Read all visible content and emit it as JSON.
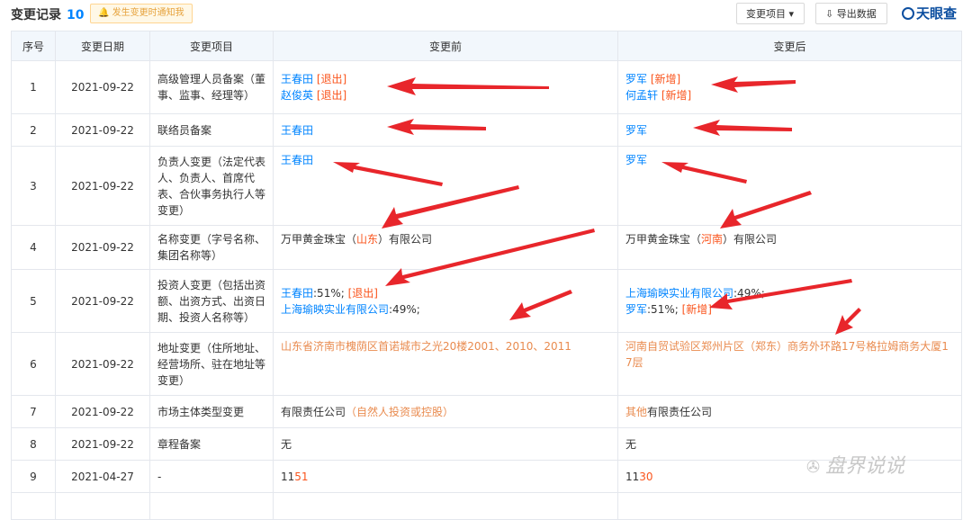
{
  "header": {
    "title": "变更记录",
    "count": "10",
    "tip": "🔔 发生变更时通知我",
    "filter_label": "变更项目 ▾",
    "export_label": "⇩ 导出数据",
    "logo": "天眼查"
  },
  "table": {
    "columns": [
      "序号",
      "变更日期",
      "变更项目",
      "变更前",
      "变更后"
    ],
    "rows": [
      {
        "no": "1",
        "date": "2021-09-22",
        "item": "高级管理人员备案（董事、监事、经理等）",
        "before": [
          {
            "n": "王春田",
            "t": "[退出]"
          },
          {
            "n": "赵俊英",
            "t": "[退出]"
          }
        ],
        "after": [
          {
            "n": "罗军",
            "t": "[新增]"
          },
          {
            "n": "何孟轩",
            "t": "[新增]"
          }
        ]
      },
      {
        "no": "2",
        "date": "2021-09-22",
        "item": "联络员备案",
        "before": "王春田",
        "after": "罗军"
      },
      {
        "no": "3",
        "date": "2021-09-22",
        "item": "负责人变更（法定代表人、负责人、首席代表、合伙事务执行人等变更）",
        "before": "王春田",
        "after": "罗军"
      },
      {
        "no": "4",
        "date": "2021-09-22",
        "item": "名称变更（字号名称、集团名称等）",
        "before": {
          "a": "万甲黄金珠宝（",
          "h": "山东",
          "b": "）有限公司"
        },
        "after": {
          "a": "万甲黄金珠宝（",
          "h": "河南",
          "b": "）有限公司"
        }
      },
      {
        "no": "5",
        "date": "2021-09-22",
        "item": "投资人变更（包括出资额、出资方式、出资日期、投资人名称等）",
        "before": {
          "l1n": "王春田",
          "l1r": ":51%; ",
          "l1t": "[退出]",
          "l2n": "上海瑜映实业有限公司",
          "l2r": ":49%;"
        },
        "after": {
          "l1n": "上海瑜映实业有限公司",
          "l1r": ":49%;",
          "l2n": "罗军",
          "l2r": ":51%; ",
          "l2t": "[新增]"
        }
      },
      {
        "no": "6",
        "date": "2021-09-22",
        "item": "地址变更（住所地址、经营场所、驻在地址等变更）",
        "before": "山东省济南市槐荫区首诺城市之光20楼2001、2010、2011",
        "after": "河南自贸试验区郑州片区（郑东）商务外环路17号格拉姆商务大厦17层"
      },
      {
        "no": "7",
        "date": "2021-09-22",
        "item": "市场主体类型变更",
        "before": {
          "a": "有限责任公司",
          "h": "（自然人投资或控股）"
        },
        "after": {
          "h": "其他",
          "a": "有限责任公司"
        }
      },
      {
        "no": "8",
        "date": "2021-09-22",
        "item": "章程备案",
        "before": "无",
        "after": "无"
      },
      {
        "no": "9",
        "date": "2021-04-27",
        "item": "-",
        "before": {
          "a": "11",
          "h": "51"
        },
        "after": {
          "a": "11",
          "h": "30"
        }
      }
    ]
  },
  "watermark": {
    "text": "盘界说说",
    "icon": "wechat-icon"
  },
  "colors": {
    "accent": "#0084ff",
    "highlight": "#fa541c",
    "arrow": "#e8262b",
    "header_bg": "#f2f7fc"
  }
}
